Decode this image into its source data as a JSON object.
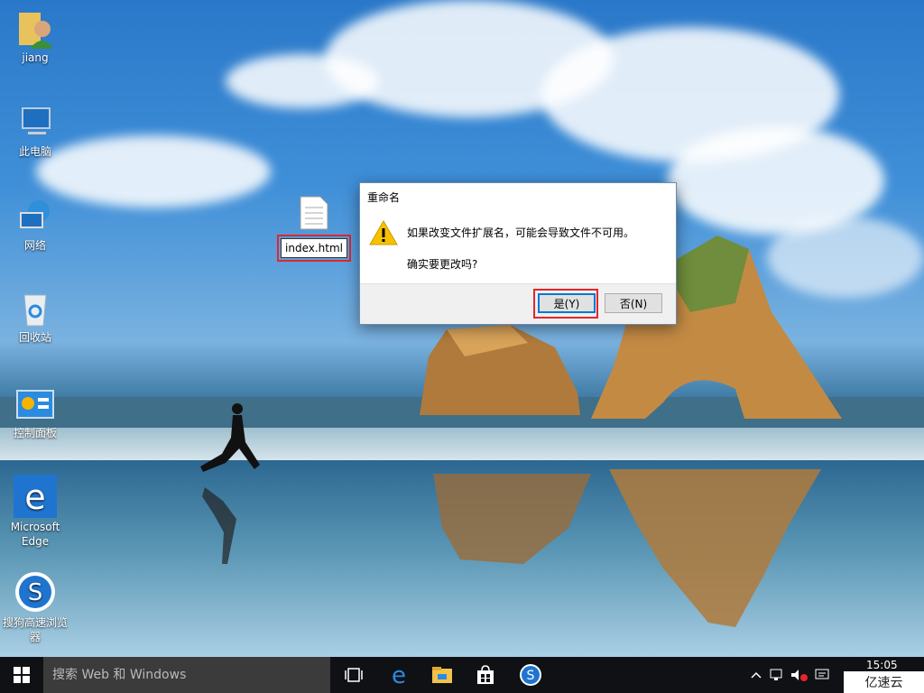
{
  "desktop": {
    "icons": [
      {
        "label": "jiang",
        "icon": "user-folder-icon"
      },
      {
        "label": "此电脑",
        "icon": "computer-icon"
      },
      {
        "label": "网络",
        "icon": "network-icon"
      },
      {
        "label": "回收站",
        "icon": "recycle-bin-icon"
      },
      {
        "label": "控制面板",
        "icon": "control-panel-icon"
      },
      {
        "label": "Microsoft Edge",
        "icon": "edge-icon"
      },
      {
        "label": "搜狗高速浏览器",
        "icon": "sogou-browser-icon"
      }
    ],
    "file": {
      "name": "index.html",
      "icon": "document-icon"
    }
  },
  "dialog": {
    "title": "重命名",
    "message": "如果改变文件扩展名，可能会导致文件不可用。",
    "question": "确实要更改吗?",
    "yes_label": "是(Y)",
    "no_label": "否(N)",
    "icon": "warning-icon"
  },
  "taskbar": {
    "search_placeholder": "搜索 Web 和 Windows",
    "apps": [
      "task-view-icon",
      "edge-icon",
      "file-explorer-icon",
      "store-icon",
      "sogou-browser-icon"
    ],
    "time": "15:05",
    "watermark": "亿速云"
  },
  "colors": {
    "highlight": "#e3262b",
    "focus": "#0078d7",
    "taskbar": "#101114"
  }
}
